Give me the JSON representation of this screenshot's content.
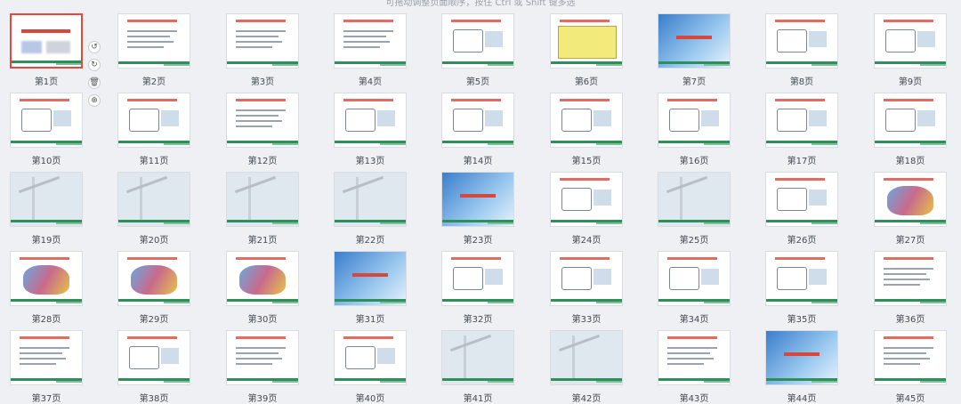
{
  "hint": "可拖动调整页面顺序，按住 Ctrl 或 Shift 键多选",
  "selected_index": 0,
  "thumb_tools": [
    {
      "icon": "rotate-left-icon",
      "glyph": "↺"
    },
    {
      "icon": "rotate-right-icon",
      "glyph": "↻"
    },
    {
      "icon": "delete-icon",
      "glyph": "🗑"
    },
    {
      "icon": "add-icon",
      "glyph": "⊕"
    }
  ],
  "pages": [
    {
      "label": "第1页",
      "style": "title"
    },
    {
      "label": "第2页",
      "style": "text"
    },
    {
      "label": "第3页",
      "style": "text"
    },
    {
      "label": "第4页",
      "style": "text"
    },
    {
      "label": "第5页",
      "style": "diagram"
    },
    {
      "label": "第6页",
      "style": "table"
    },
    {
      "label": "第7页",
      "style": "blue"
    },
    {
      "label": "第8页",
      "style": "diagram"
    },
    {
      "label": "第9页",
      "style": "diagram"
    },
    {
      "label": "第10页",
      "style": "diagram"
    },
    {
      "label": "第11页",
      "style": "diagram"
    },
    {
      "label": "第12页",
      "style": "text"
    },
    {
      "label": "第13页",
      "style": "diagram"
    },
    {
      "label": "第14页",
      "style": "diagram"
    },
    {
      "label": "第15页",
      "style": "diagram"
    },
    {
      "label": "第16页",
      "style": "diagram"
    },
    {
      "label": "第17页",
      "style": "diagram"
    },
    {
      "label": "第18页",
      "style": "diagram"
    },
    {
      "label": "第19页",
      "style": "photo"
    },
    {
      "label": "第20页",
      "style": "photo"
    },
    {
      "label": "第21页",
      "style": "photo"
    },
    {
      "label": "第22页",
      "style": "photo"
    },
    {
      "label": "第23页",
      "style": "blue"
    },
    {
      "label": "第24页",
      "style": "diagram"
    },
    {
      "label": "第25页",
      "style": "photo"
    },
    {
      "label": "第26页",
      "style": "diagram"
    },
    {
      "label": "第27页",
      "style": "map"
    },
    {
      "label": "第28页",
      "style": "map"
    },
    {
      "label": "第29页",
      "style": "map"
    },
    {
      "label": "第30页",
      "style": "map"
    },
    {
      "label": "第31页",
      "style": "blue"
    },
    {
      "label": "第32页",
      "style": "diagram"
    },
    {
      "label": "第33页",
      "style": "diagram"
    },
    {
      "label": "第34页",
      "style": "diagram"
    },
    {
      "label": "第35页",
      "style": "diagram"
    },
    {
      "label": "第36页",
      "style": "text"
    },
    {
      "label": "第37页",
      "style": "text"
    },
    {
      "label": "第38页",
      "style": "diagram"
    },
    {
      "label": "第39页",
      "style": "text"
    },
    {
      "label": "第40页",
      "style": "diagram"
    },
    {
      "label": "第41页",
      "style": "photo"
    },
    {
      "label": "第42页",
      "style": "photo"
    },
    {
      "label": "第43页",
      "style": "text"
    },
    {
      "label": "第44页",
      "style": "blue"
    },
    {
      "label": "第45页",
      "style": "text"
    }
  ]
}
